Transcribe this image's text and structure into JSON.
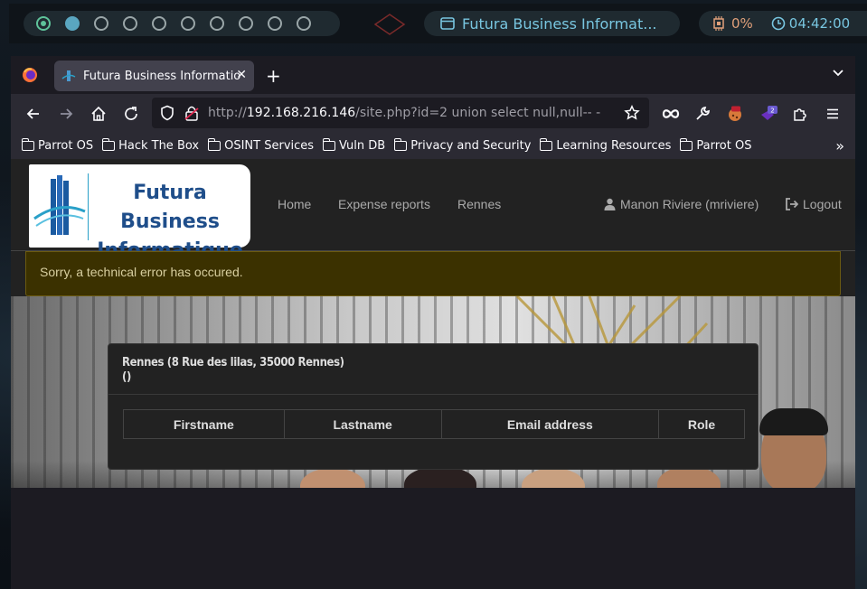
{
  "panel_top": {
    "workspaces": 10,
    "active_task": "Futura Business Informat...",
    "cpu": "0%",
    "clock": "04:42:00"
  },
  "browser": {
    "tab_title": "Futura Business Informatio",
    "url_scheme": "http://",
    "url_host": "192.168.216.146",
    "url_path": "/site.php?id=2 union select null,null-- -",
    "extension_badge": "2",
    "bookmarks": [
      "Parrot OS",
      "Hack The Box",
      "OSINT Services",
      "Vuln DB",
      "Privacy and Security",
      "Learning Resources",
      "Parrot OS"
    ]
  },
  "site": {
    "logo_line1": "Futura Business",
    "logo_line2": "Informatique",
    "nav": {
      "home": "Home",
      "expense": "Expense reports",
      "rennes": "Rennes"
    },
    "user": "Manon Riviere (mriviere)",
    "logout": "Logout",
    "alert": "Sorry, a technical error has occured.",
    "panel": {
      "title_line1": "Rennes (8 Rue des lilas, 35000 Rennes)",
      "title_line2": "()",
      "columns": [
        "Firstname",
        "Lastname",
        "Email address",
        "Role"
      ]
    }
  },
  "colors": {
    "accent": "#78c6e0",
    "alert_bg": "#3b3100"
  }
}
